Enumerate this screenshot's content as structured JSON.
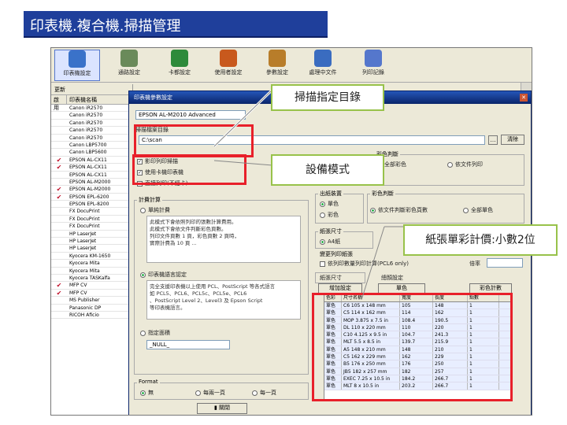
{
  "slide": {
    "title": "印表機.複合機.掃描管理"
  },
  "toolbar": {
    "items": [
      {
        "label": "印表機設定",
        "color": "#3a72c9"
      },
      {
        "label": "通路設定",
        "color": "#6a8a5a"
      },
      {
        "label": "卡都設定",
        "color": "#2d8a3a"
      },
      {
        "label": "使用者設定",
        "color": "#c8591d"
      },
      {
        "label": "參數設定",
        "color": "#b87d2a"
      },
      {
        "label": "處理中文件",
        "color": "#3a6cc0"
      },
      {
        "label": "列印記錄",
        "color": "#5577cc"
      }
    ]
  },
  "left_panel": {
    "header": "更新",
    "col_a": "啟用",
    "col_b": "印表機名稱",
    "rows": [
      {
        "checked": false,
        "name": "Canon iR2570"
      },
      {
        "checked": false,
        "name": "Canon iR2570"
      },
      {
        "checked": false,
        "name": "Canon iR2570"
      },
      {
        "checked": false,
        "name": "Canon iR2570"
      },
      {
        "checked": false,
        "name": "Canon iR2570"
      },
      {
        "checked": false,
        "name": "Canon LBP5700"
      },
      {
        "checked": false,
        "name": "Canon LBP5600"
      },
      {
        "checked": true,
        "name": "EPSON AL-CX11"
      },
      {
        "checked": true,
        "name": "EPSON AL-CX11"
      },
      {
        "checked": false,
        "name": "EPSON AL-CX11"
      },
      {
        "checked": false,
        "name": "EPSON AL-M2000"
      },
      {
        "checked": true,
        "name": "EPSON AL-M2000"
      },
      {
        "checked": true,
        "name": "EPSON EPL-6200"
      },
      {
        "checked": false,
        "name": "EPSON EPL-8200"
      },
      {
        "checked": false,
        "name": "FX DocuPrint"
      },
      {
        "checked": false,
        "name": "FX DocuPrint"
      },
      {
        "checked": false,
        "name": "FX DocuPrint"
      },
      {
        "checked": false,
        "name": "HP LaserJet"
      },
      {
        "checked": false,
        "name": "HP LaserJet"
      },
      {
        "checked": false,
        "name": "HP LaserJet"
      },
      {
        "checked": false,
        "name": "Kyocera KM-1650"
      },
      {
        "checked": false,
        "name": "Kyocera Mita"
      },
      {
        "checked": false,
        "name": "Kyocera Mita"
      },
      {
        "checked": false,
        "name": "Kyocera TASKalfa"
      },
      {
        "checked": true,
        "name": "MFP CV"
      },
      {
        "checked": true,
        "name": "MFP CV"
      },
      {
        "checked": false,
        "name": "MS Publisher"
      },
      {
        "checked": false,
        "name": "Panasonic DP"
      },
      {
        "checked": false,
        "name": "RICOH Aficio"
      }
    ]
  },
  "dialog": {
    "title": "印表機參數設定",
    "device_name": "EPSON AL-M2010 Advanced",
    "scan_dir_label": "掃描檔案目錄",
    "scan_dir_value": "C:\\scan",
    "clear_button": "清除",
    "cb1": "影印列印掃描",
    "cb2": "使用卡機印表機",
    "cb3": "直接列印(不經卡)",
    "group_color": "彩色判斷",
    "color_opt1": "全部彩色",
    "color_opt2": "依文件列印",
    "group_io": "出紙裝置",
    "io_opt1": "單色",
    "io_opt2": "彩色",
    "group_paper": "紙張尺寸",
    "paper_opt": "A4紙",
    "group_judge": "彩色判斷",
    "judge_opt1": "依文件判斷彩色頁數",
    "judge_opt2": "全部單色",
    "group_extra": "變更列印紙張",
    "extra_cb": "依列印數量列印計算(PCL6 only)",
    "extra_rate_label": "倍率",
    "group_calc": "計費計算",
    "calc_opt1": "單純計費",
    "calc_note": "此模式下會依照列印的張數計算費用。\n此模式下會依文件判斷彩色頁數。\n列印文件頁數 1 頁，彩色頁數 2 頁時，\n實際計費為 10 頁 ...",
    "calc_opt2": "印表機語言認定",
    "calc_note2": "完全支援印表機以上使用 PCL、PostScript 等各式語言\n如 PCL5、PCL6、PCL5c、PCL5e、PCL6\n、PostScript Level 2、Level3 及 Epson Script\n等印表機語言。",
    "calc_opt3": "指定面積",
    "calc_select": "_NULL_",
    "group_format": "Format",
    "fmt_opt1": "無",
    "fmt_opt2": "每兩一頁",
    "fmt_opt3": "每一頁",
    "close_button": "關閉",
    "paper_tab": "紙張尺寸",
    "paper_add_button": "增加設定",
    "paper_set_label": "總顏設定",
    "paper_set_value": "單色",
    "paper_set_btn": "彩色計數",
    "paper_table": {
      "headers": [
        "色彩",
        "尺寸名稱",
        "寬度",
        "長度",
        "點數"
      ],
      "rows": [
        [
          "單色",
          "C6 105 x 148 mm",
          "105",
          "148",
          "1"
        ],
        [
          "單色",
          "C5 114 x 162 mm",
          "114",
          "162",
          "1"
        ],
        [
          "單色",
          "MOP 3.875 x 7.5 in",
          "108.4",
          "190.5",
          "1"
        ],
        [
          "單色",
          "DL 110 x 220 mm",
          "110",
          "220",
          "1"
        ],
        [
          "單色",
          "C10 4.125 x 9.5 in",
          "104.7",
          "241.3",
          "1"
        ],
        [
          "單色",
          "MLT 5.5 x 8.5 in",
          "139.7",
          "215.9",
          "1"
        ],
        [
          "單色",
          "A5 148 x 210 mm",
          "148",
          "210",
          "1"
        ],
        [
          "單色",
          "C5 162 x 229 mm",
          "162",
          "229",
          "1"
        ],
        [
          "單色",
          "B5 176 x 250 mm",
          "176",
          "250",
          "1"
        ],
        [
          "單色",
          "JB5 182 x 257 mm",
          "182",
          "257",
          "1"
        ],
        [
          "單色",
          "EXEC 7.25 x 10.5 in",
          "184.2",
          "266.7",
          "1"
        ],
        [
          "單色",
          "MLT 8 x 10.5 in",
          "203.2",
          "266.7",
          "1"
        ]
      ]
    }
  },
  "callouts": {
    "scan_dir": "掃描指定目錄",
    "device_mode": "設備模式",
    "paper_price": "紙張單彩計價:小數2位"
  }
}
